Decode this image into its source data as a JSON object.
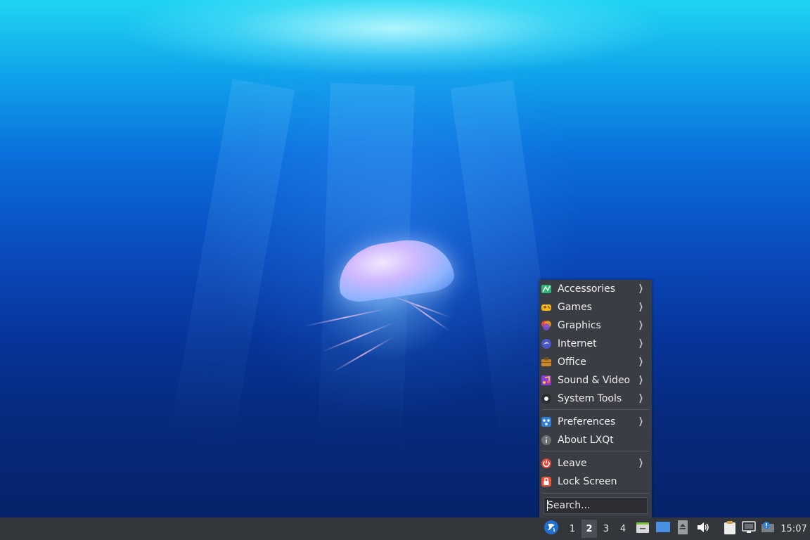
{
  "menu": {
    "items": [
      {
        "label": "Accessories",
        "icon": "accessories-icon",
        "submenu": true
      },
      {
        "label": "Games",
        "icon": "games-icon",
        "submenu": true
      },
      {
        "label": "Graphics",
        "icon": "graphics-icon",
        "submenu": true
      },
      {
        "label": "Internet",
        "icon": "internet-icon",
        "submenu": true
      },
      {
        "label": "Office",
        "icon": "office-icon",
        "submenu": true
      },
      {
        "label": "Sound & Video",
        "icon": "sound-video-icon",
        "submenu": true
      },
      {
        "label": "System Tools",
        "icon": "system-tools-icon",
        "submenu": true
      },
      {
        "label": "Preferences",
        "icon": "preferences-icon",
        "submenu": true
      },
      {
        "label": "About LXQt",
        "icon": "info-icon",
        "submenu": false
      },
      {
        "label": "Leave",
        "icon": "power-icon",
        "submenu": true
      },
      {
        "label": "Lock Screen",
        "icon": "lock-icon",
        "submenu": false
      }
    ],
    "search_placeholder": "Search..."
  },
  "taskbar": {
    "desktops": [
      "1",
      "2",
      "3",
      "4"
    ],
    "active_desktop": "2",
    "clock": "15:07"
  },
  "colors": {
    "menu_bg": "#3a3d43",
    "taskbar_bg": "#33363b",
    "accent": "#2f7fd8"
  }
}
